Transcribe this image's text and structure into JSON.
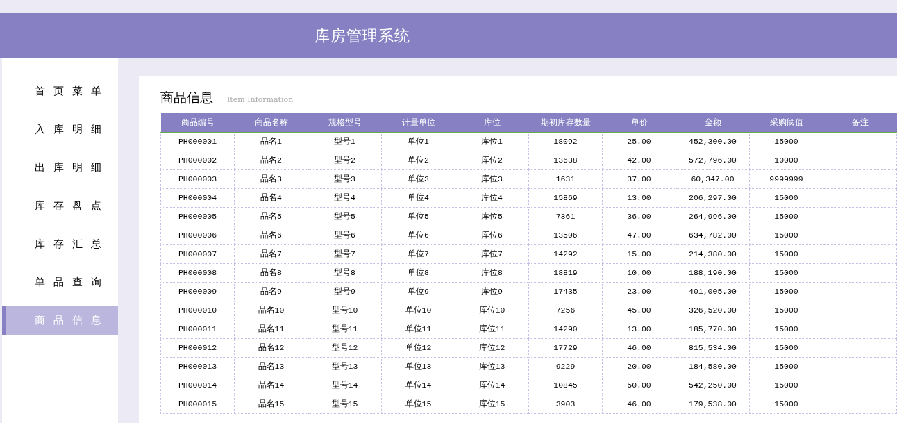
{
  "header": {
    "title": "库房管理系统"
  },
  "sidebar": {
    "items": [
      {
        "label": "首页菜单",
        "selected": false
      },
      {
        "label": "入库明细",
        "selected": false
      },
      {
        "label": "出库明细",
        "selected": false
      },
      {
        "label": "库存盘点",
        "selected": false
      },
      {
        "label": "库存汇总",
        "selected": false
      },
      {
        "label": "单品查询",
        "selected": false
      },
      {
        "label": "商品信息",
        "selected": true
      }
    ]
  },
  "page": {
    "title": "商品信息",
    "subtitle": "Item Information"
  },
  "table": {
    "columns": [
      "商品编号",
      "商品名称",
      "规格型号",
      "计量单位",
      "库位",
      "期初库存数量",
      "单价",
      "金额",
      "采购阈值",
      "备注"
    ],
    "rows": [
      [
        "PH000001",
        "品名1",
        "型号1",
        "单位1",
        "库位1",
        "18092",
        "25.00",
        "452,300.00",
        "15000"
      ],
      [
        "PH000002",
        "品名2",
        "型号2",
        "单位2",
        "库位2",
        "13638",
        "42.00",
        "572,796.00",
        "10000"
      ],
      [
        "PH000003",
        "品名3",
        "型号3",
        "单位3",
        "库位3",
        "1631",
        "37.00",
        "60,347.00",
        "9999999"
      ],
      [
        "PH000004",
        "品名4",
        "型号4",
        "单位4",
        "库位4",
        "15869",
        "13.00",
        "206,297.00",
        "15000"
      ],
      [
        "PH000005",
        "品名5",
        "型号5",
        "单位5",
        "库位5",
        "7361",
        "36.00",
        "264,996.00",
        "15000"
      ],
      [
        "PH000006",
        "品名6",
        "型号6",
        "单位6",
        "库位6",
        "13506",
        "47.00",
        "634,782.00",
        "15000"
      ],
      [
        "PH000007",
        "品名7",
        "型号7",
        "单位7",
        "库位7",
        "14292",
        "15.00",
        "214,380.00",
        "15000"
      ],
      [
        "PH000008",
        "品名8",
        "型号8",
        "单位8",
        "库位8",
        "18819",
        "10.00",
        "188,190.00",
        "15000"
      ],
      [
        "PH000009",
        "品名9",
        "型号9",
        "单位9",
        "库位9",
        "17435",
        "23.00",
        "401,005.00",
        "15000"
      ],
      [
        "PH000010",
        "品名10",
        "型号10",
        "单位10",
        "库位10",
        "7256",
        "45.00",
        "326,520.00",
        "15000"
      ],
      [
        "PH000011",
        "品名11",
        "型号11",
        "单位11",
        "库位11",
        "14290",
        "13.00",
        "185,770.00",
        "15000"
      ],
      [
        "PH000012",
        "品名12",
        "型号12",
        "单位12",
        "库位12",
        "17729",
        "46.00",
        "815,534.00",
        "15000"
      ],
      [
        "PH000013",
        "品名13",
        "型号13",
        "单位13",
        "库位13",
        "9229",
        "20.00",
        "184,580.00",
        "15000"
      ],
      [
        "PH000014",
        "品名14",
        "型号14",
        "单位14",
        "库位14",
        "10845",
        "50.00",
        "542,250.00",
        "15000"
      ],
      [
        "PH000015",
        "品名15",
        "型号15",
        "单位15",
        "库位15",
        "3903",
        "46.00",
        "179,538.00",
        "15000"
      ]
    ]
  }
}
